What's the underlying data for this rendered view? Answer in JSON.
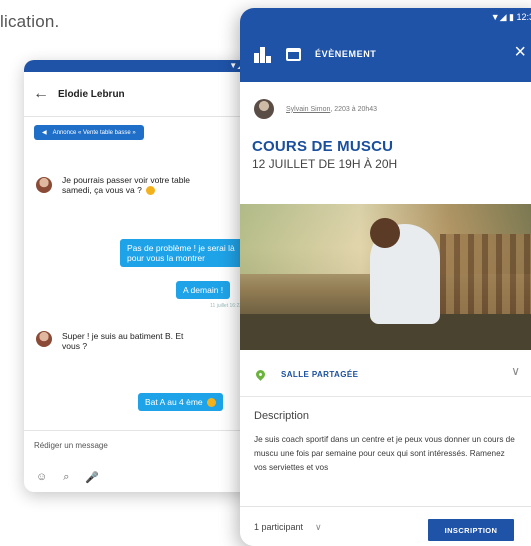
{
  "caption": "lication.",
  "chat": {
    "status_text": "▼◢ ▮",
    "back_icon": "back-arrow-icon",
    "contact_name": "Elodie Lebrun",
    "annonce_chip": "Annonce « Vente table basse »",
    "messages": [
      {
        "direction": "in",
        "text": "Je pourrais passer voir votre table samedi, ça vous va ?"
      },
      {
        "direction": "out",
        "text": "Pas de problème ! je serai là pour vous la montrer"
      },
      {
        "direction": "out",
        "text": "A demain !"
      },
      {
        "direction": "in",
        "text": "Super ! je suis au batiment B. Et vous ?"
      },
      {
        "direction": "out",
        "text": "Bat A au 4 ème"
      }
    ],
    "sent_meta": "11 juillet 16:23",
    "compose_placeholder": "Rédiger un message",
    "tools": [
      "☺",
      "⌕",
      "🎤"
    ]
  },
  "event": {
    "status_text": "▼◢ ▮ 12:3",
    "header_title": "ÉVÈNEMENT",
    "close_icon": "×",
    "author_name": "Sylvain Simon",
    "author_meta": ", 2203 à 20h43",
    "title": "COURS DE MUSCU",
    "date": "12 JUILLET DE 19H À 20H",
    "location": "SALLE PARTAGÉE",
    "description_title": "Description",
    "description": "Je suis coach sportif dans un centre et je peux vous donner un cours de muscu une fois par semaine pour ceux qui sont intéressés. Ramenez vos serviettes et vos",
    "participants": "1 participant",
    "register_label": "INSCRIPTION"
  },
  "colors": {
    "brand_blue": "#1f53a8",
    "bubble_blue": "#1fa3e8",
    "pin_green": "#6ab43c"
  }
}
